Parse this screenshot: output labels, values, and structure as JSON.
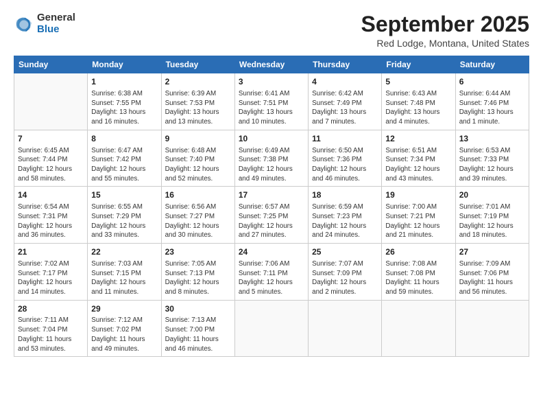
{
  "header": {
    "logo_general": "General",
    "logo_blue": "Blue",
    "month": "September 2025",
    "location": "Red Lodge, Montana, United States"
  },
  "weekdays": [
    "Sunday",
    "Monday",
    "Tuesday",
    "Wednesday",
    "Thursday",
    "Friday",
    "Saturday"
  ],
  "weeks": [
    [
      {
        "day": "",
        "info": ""
      },
      {
        "day": "1",
        "info": "Sunrise: 6:38 AM\nSunset: 7:55 PM\nDaylight: 13 hours\nand 16 minutes."
      },
      {
        "day": "2",
        "info": "Sunrise: 6:39 AM\nSunset: 7:53 PM\nDaylight: 13 hours\nand 13 minutes."
      },
      {
        "day": "3",
        "info": "Sunrise: 6:41 AM\nSunset: 7:51 PM\nDaylight: 13 hours\nand 10 minutes."
      },
      {
        "day": "4",
        "info": "Sunrise: 6:42 AM\nSunset: 7:49 PM\nDaylight: 13 hours\nand 7 minutes."
      },
      {
        "day": "5",
        "info": "Sunrise: 6:43 AM\nSunset: 7:48 PM\nDaylight: 13 hours\nand 4 minutes."
      },
      {
        "day": "6",
        "info": "Sunrise: 6:44 AM\nSunset: 7:46 PM\nDaylight: 13 hours\nand 1 minute."
      }
    ],
    [
      {
        "day": "7",
        "info": "Sunrise: 6:45 AM\nSunset: 7:44 PM\nDaylight: 12 hours\nand 58 minutes."
      },
      {
        "day": "8",
        "info": "Sunrise: 6:47 AM\nSunset: 7:42 PM\nDaylight: 12 hours\nand 55 minutes."
      },
      {
        "day": "9",
        "info": "Sunrise: 6:48 AM\nSunset: 7:40 PM\nDaylight: 12 hours\nand 52 minutes."
      },
      {
        "day": "10",
        "info": "Sunrise: 6:49 AM\nSunset: 7:38 PM\nDaylight: 12 hours\nand 49 minutes."
      },
      {
        "day": "11",
        "info": "Sunrise: 6:50 AM\nSunset: 7:36 PM\nDaylight: 12 hours\nand 46 minutes."
      },
      {
        "day": "12",
        "info": "Sunrise: 6:51 AM\nSunset: 7:34 PM\nDaylight: 12 hours\nand 43 minutes."
      },
      {
        "day": "13",
        "info": "Sunrise: 6:53 AM\nSunset: 7:33 PM\nDaylight: 12 hours\nand 39 minutes."
      }
    ],
    [
      {
        "day": "14",
        "info": "Sunrise: 6:54 AM\nSunset: 7:31 PM\nDaylight: 12 hours\nand 36 minutes."
      },
      {
        "day": "15",
        "info": "Sunrise: 6:55 AM\nSunset: 7:29 PM\nDaylight: 12 hours\nand 33 minutes."
      },
      {
        "day": "16",
        "info": "Sunrise: 6:56 AM\nSunset: 7:27 PM\nDaylight: 12 hours\nand 30 minutes."
      },
      {
        "day": "17",
        "info": "Sunrise: 6:57 AM\nSunset: 7:25 PM\nDaylight: 12 hours\nand 27 minutes."
      },
      {
        "day": "18",
        "info": "Sunrise: 6:59 AM\nSunset: 7:23 PM\nDaylight: 12 hours\nand 24 minutes."
      },
      {
        "day": "19",
        "info": "Sunrise: 7:00 AM\nSunset: 7:21 PM\nDaylight: 12 hours\nand 21 minutes."
      },
      {
        "day": "20",
        "info": "Sunrise: 7:01 AM\nSunset: 7:19 PM\nDaylight: 12 hours\nand 18 minutes."
      }
    ],
    [
      {
        "day": "21",
        "info": "Sunrise: 7:02 AM\nSunset: 7:17 PM\nDaylight: 12 hours\nand 14 minutes."
      },
      {
        "day": "22",
        "info": "Sunrise: 7:03 AM\nSunset: 7:15 PM\nDaylight: 12 hours\nand 11 minutes."
      },
      {
        "day": "23",
        "info": "Sunrise: 7:05 AM\nSunset: 7:13 PM\nDaylight: 12 hours\nand 8 minutes."
      },
      {
        "day": "24",
        "info": "Sunrise: 7:06 AM\nSunset: 7:11 PM\nDaylight: 12 hours\nand 5 minutes."
      },
      {
        "day": "25",
        "info": "Sunrise: 7:07 AM\nSunset: 7:09 PM\nDaylight: 12 hours\nand 2 minutes."
      },
      {
        "day": "26",
        "info": "Sunrise: 7:08 AM\nSunset: 7:08 PM\nDaylight: 11 hours\nand 59 minutes."
      },
      {
        "day": "27",
        "info": "Sunrise: 7:09 AM\nSunset: 7:06 PM\nDaylight: 11 hours\nand 56 minutes."
      }
    ],
    [
      {
        "day": "28",
        "info": "Sunrise: 7:11 AM\nSunset: 7:04 PM\nDaylight: 11 hours\nand 53 minutes."
      },
      {
        "day": "29",
        "info": "Sunrise: 7:12 AM\nSunset: 7:02 PM\nDaylight: 11 hours\nand 49 minutes."
      },
      {
        "day": "30",
        "info": "Sunrise: 7:13 AM\nSunset: 7:00 PM\nDaylight: 11 hours\nand 46 minutes."
      },
      {
        "day": "",
        "info": ""
      },
      {
        "day": "",
        "info": ""
      },
      {
        "day": "",
        "info": ""
      },
      {
        "day": "",
        "info": ""
      }
    ]
  ]
}
